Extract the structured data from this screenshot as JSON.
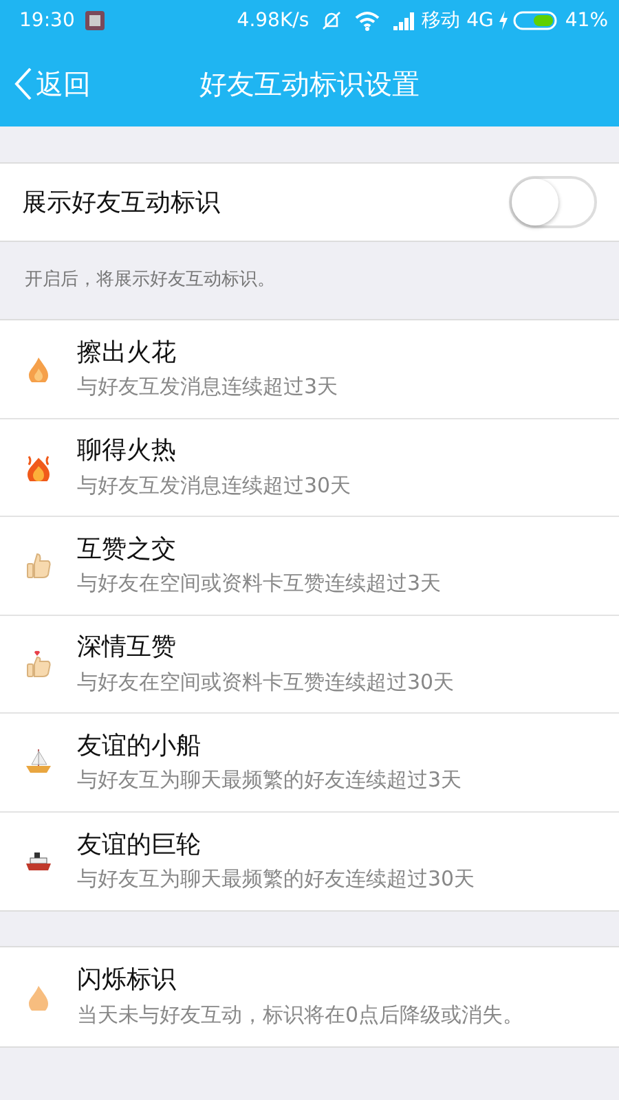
{
  "status_bar": {
    "time": "19:30",
    "speed": "4.98K/s",
    "carrier": "移动 4G",
    "battery": "41%"
  },
  "nav": {
    "back": "返回",
    "title": "好友互动标识设置"
  },
  "toggle": {
    "label": "展示好友互动标识",
    "on": false
  },
  "hint": "开启后，将展示好友互动标识。",
  "groups": [
    [
      {
        "kind": "spark",
        "title": "擦出火花",
        "desc": "与好友互发消息连续超过3天"
      },
      {
        "kind": "fire",
        "title": "聊得火热",
        "desc": "与好友互发消息连续超过30天"
      },
      {
        "kind": "thumb",
        "title": "互赞之交",
        "desc": "与好友在空间或资料卡互赞连续超过3天"
      },
      {
        "kind": "heart-thumb",
        "title": "深情互赞",
        "desc": "与好友在空间或资料卡互赞连续超过30天"
      },
      {
        "kind": "boat",
        "title": "友谊的小船",
        "desc": "与好友互为聊天最频繁的好友连续超过3天"
      },
      {
        "kind": "ship",
        "title": "友谊的巨轮",
        "desc": "与好友互为聊天最频繁的好友连续超过30天"
      }
    ],
    [
      {
        "kind": "faded-spark",
        "title": "闪烁标识",
        "desc": "当天未与好友互动，标识将在0点后降级或消失。"
      }
    ]
  ]
}
